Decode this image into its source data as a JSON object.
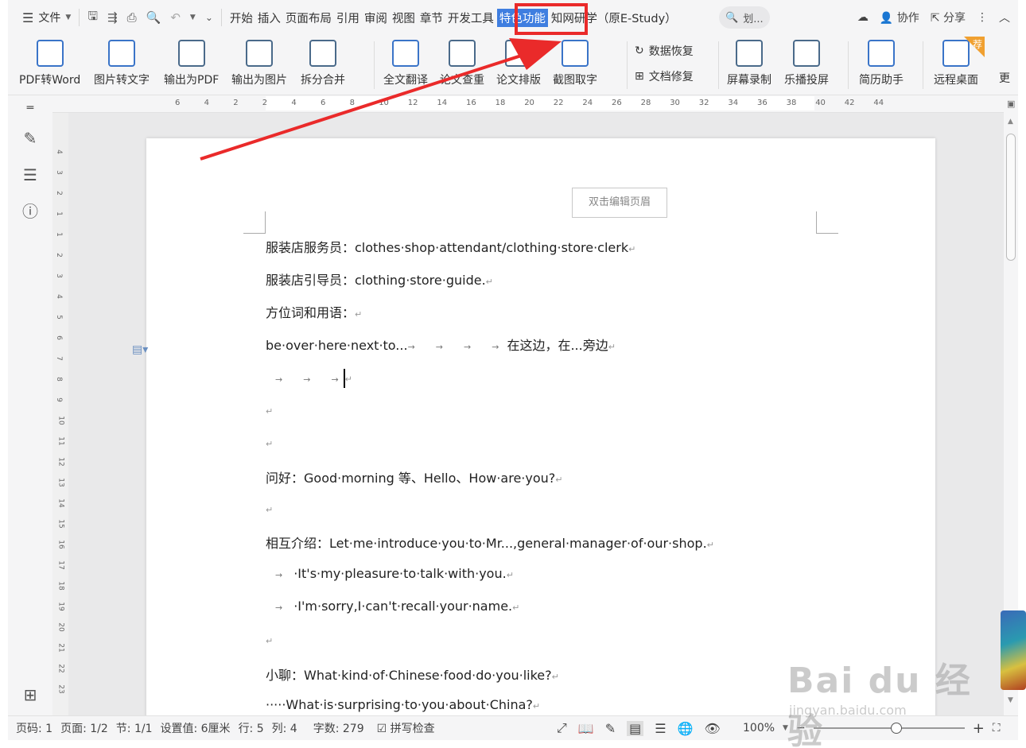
{
  "menubar": {
    "file_label": "文件",
    "tabs": [
      "开始",
      "插入",
      "页面布局",
      "引用",
      "审阅",
      "视图",
      "章节",
      "开发工具",
      "特色功能",
      "知网研学（原E-Study）"
    ],
    "active_tab": "特色功能",
    "search_placeholder": "划...",
    "collaborate": "协作",
    "share": "分享"
  },
  "ribbon": {
    "buttons": [
      "PDF转Word",
      "图片转文字",
      "输出为PDF",
      "输出为图片",
      "拆分合并",
      "全文翻译",
      "论文查重",
      "论文排版",
      "截图取字"
    ],
    "recover_data": "数据恢复",
    "repair_doc": "文档修复",
    "screen_record": "屏幕录制",
    "cast": "乐播投屏",
    "resume": "简历助手",
    "remote": "远程桌面",
    "recommend_badge": "荐",
    "more_partial": "更"
  },
  "ruler": {
    "top_ticks": [
      "6",
      "4",
      "2",
      "2",
      "4",
      "6",
      "8",
      "10",
      "12",
      "14",
      "16",
      "18",
      "20",
      "22",
      "24",
      "26",
      "28",
      "30",
      "32",
      "34",
      "36",
      "38",
      "40",
      "42",
      "44"
    ],
    "left_ticks": [
      "4",
      "3",
      "2",
      "1",
      "1",
      "2",
      "3",
      "4",
      "5",
      "6",
      "7",
      "8",
      "9",
      "10",
      "11",
      "12",
      "13",
      "14",
      "15",
      "16",
      "17",
      "18",
      "19",
      "20",
      "21",
      "22",
      "23"
    ]
  },
  "document": {
    "header_hint": "双击编辑页眉",
    "lines": [
      "服装店服务员：clothes·shop·attendant/clothing·store·clerk",
      "服装店引导员：clothing·store·guide.",
      "方位词和用语：",
      "be·over·here·next·to...",
      "在这边，在...旁边",
      "",
      "",
      "",
      "问好：Good·morning 等、Hello、How·are·you?",
      "",
      "相互介绍：Let·me·introduce·you·to·Mr...,general·manager·of·our·shop.",
      "·It's·my·pleasure·to·talk·with·you.",
      "·I'm·sorry,I·can't·recall·your·name.",
      "",
      "小聊：What·kind·of·Chinese·food·do·you·like?",
      "·····What·is·surprising·to·you·about·China?"
    ],
    "para_mark": "↵",
    "tab_mark": "→"
  },
  "status": {
    "page_code": "页码: 1",
    "page": "页面: 1/2",
    "section": "节: 1/1",
    "setting": "设置值: 6厘米",
    "row": "行: 5",
    "col": "列: 4",
    "words": "字数: 279",
    "spellcheck": "拼写检查",
    "zoom": "100%",
    "zoom_level": 0.5
  },
  "watermark": {
    "brand": "Bai du 经验",
    "url": "jingyan.baidu.com"
  },
  "colors": {
    "active_tab_bg": "#3f7ee0",
    "annotation": "#ea2a2a",
    "badge": "#f0a030"
  }
}
